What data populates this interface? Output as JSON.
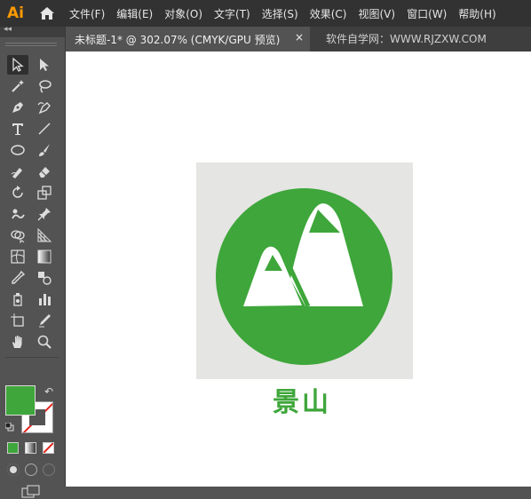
{
  "app": {
    "logo_text": "Ai"
  },
  "menu": [
    "文件(F)",
    "编辑(E)",
    "对象(O)",
    "文字(T)",
    "选择(S)",
    "效果(C)",
    "视图(V)",
    "窗口(W)",
    "帮助(H)"
  ],
  "tabs": {
    "document": "未标题-1* @ 302.07% (CMYK/GPU 预览)",
    "close": "×",
    "watermark": "软件自学网：WWW.RJZXW.COM"
  },
  "toolbar": {
    "collapse": "◂◂",
    "swap": "↶",
    "tools": [
      "selection-tool",
      "direct-selection-tool",
      "magic-wand-tool",
      "lasso-tool",
      "pen-tool",
      "curvature-tool",
      "type-tool",
      "line-segment-tool",
      "ellipse-tool",
      "paintbrush-tool",
      "shaper-tool",
      "eraser-tool",
      "rotate-tool",
      "scale-tool",
      "puppet-warp-tool",
      "pin-tool",
      "shape-builder-tool",
      "perspective-grid-tool",
      "mesh-tool",
      "gradient-tool",
      "eyedropper-tool",
      "blend-tool",
      "symbol-sprayer-tool",
      "column-graph-tool",
      "artboard-tool",
      "slice-tool",
      "hand-tool",
      "zoom-tool"
    ]
  },
  "colors": {
    "fill": "#3ea63a",
    "stroke": "none",
    "accent_orange": "#ff9a00"
  },
  "artwork": {
    "caption": "景山",
    "brand_color": "#3ea63a",
    "artboard_bg": "#e5e5e3"
  }
}
